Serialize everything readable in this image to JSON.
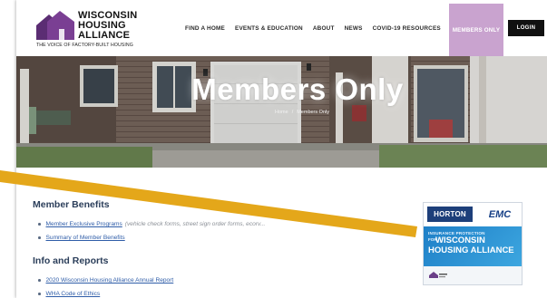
{
  "logo": {
    "line1": "WISCONSIN",
    "line2": "HOUSING",
    "line3": "ALLIANCE",
    "tagline": "THE VOICE OF FACTORY-BUILT HOUSING"
  },
  "nav": {
    "items": [
      "FIND A HOME",
      "EVENTS & EDUCATION",
      "ABOUT",
      "NEWS",
      "COVID-19 RESOURCES"
    ],
    "active": "MEMBERS ONLY",
    "login": "LOGIN"
  },
  "hero": {
    "title": "Members Only",
    "breadcrumb": [
      "Home",
      "/",
      "Members Only"
    ]
  },
  "sections": [
    {
      "heading": "Member Benefits",
      "items": [
        {
          "link": "Member Exclusive Programs",
          "note": "(vehicle check forms, street sign order forms, ecorv..."
        },
        {
          "link": "Summary of Member Benefits",
          "note": ""
        }
      ]
    },
    {
      "heading": "Info and Reports",
      "items": [
        {
          "link": "2020 Wisconsin Housing Alliance Annual Report",
          "note": ""
        },
        {
          "link": "WHA Code of Ethics",
          "note": ""
        }
      ]
    }
  ],
  "ad": {
    "brand1": "HORTON",
    "brand2": "EMC",
    "small": "INSURANCE PROTECTION",
    "for": "FOR",
    "line1": "WISCONSIN",
    "line2": "HOUSING ALLIANCE"
  },
  "colors": {
    "accent_purple": "#c9a3cf",
    "stripe_orange": "#e4a71a",
    "heading_navy": "#2b3e5a",
    "link_blue": "#2f5da8"
  }
}
